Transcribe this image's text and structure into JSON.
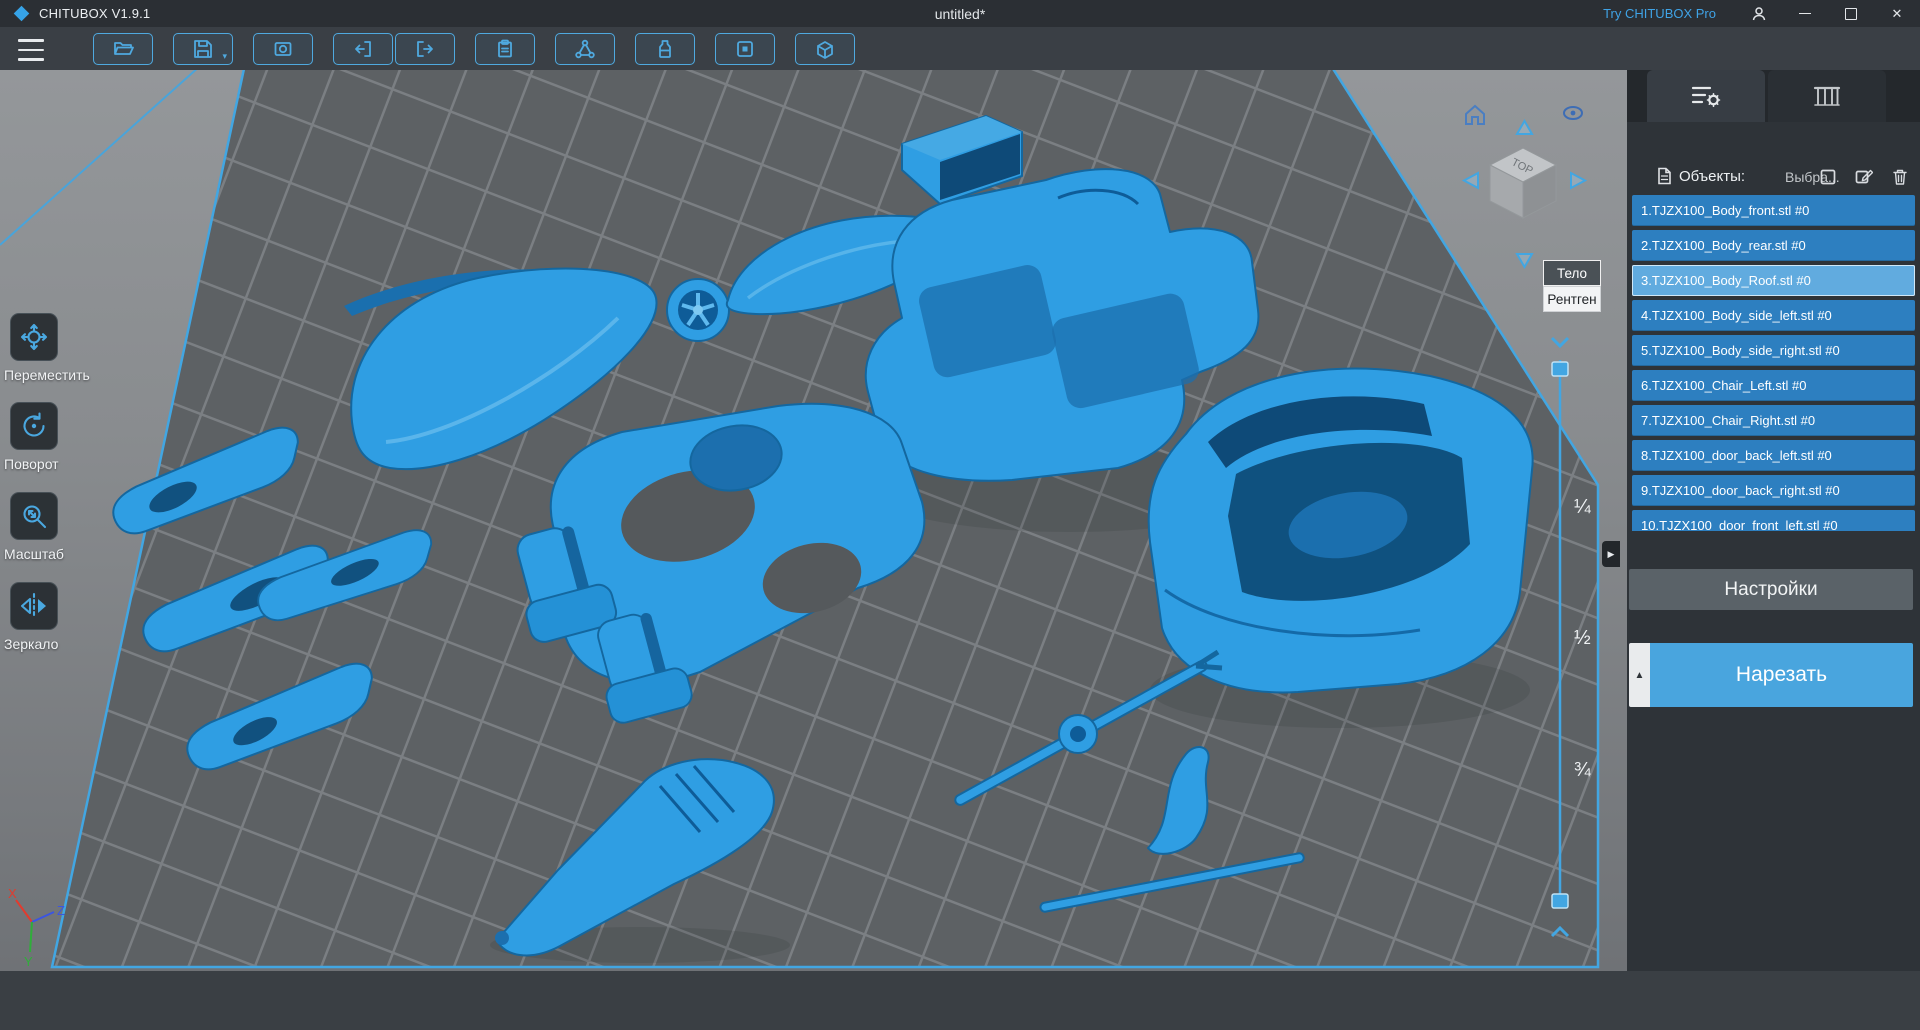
{
  "app": {
    "title": "CHITUBOX V1.9.1",
    "document": "untitled*",
    "pro_link": "Try CHITUBOX Pro"
  },
  "toolbar": {
    "icons": [
      "open-file",
      "save",
      "capture",
      "undo",
      "redo",
      "copy",
      "supports",
      "tank",
      "plate",
      "machine"
    ]
  },
  "left_tools": {
    "items": [
      {
        "icon": "move",
        "label": "Переместить"
      },
      {
        "icon": "rotate",
        "label": "Поворот"
      },
      {
        "icon": "scale",
        "label": "Масштаб"
      },
      {
        "icon": "mirror",
        "label": "Зеркало"
      }
    ]
  },
  "viewport": {
    "view_cube": {
      "top_label": "TOP"
    },
    "view_mode_menu": {
      "options": [
        {
          "label": "Тело",
          "active": true
        },
        {
          "label": "Рентген",
          "active": false
        }
      ]
    },
    "clip_slider": {
      "labels": [
        "¼",
        "½",
        "¾"
      ]
    },
    "axis_gizmo": {
      "x": "X",
      "y": "Y",
      "z": "Z"
    }
  },
  "right_panel": {
    "tabs": [
      {
        "icon": "settings-list",
        "active": true
      },
      {
        "icon": "supports",
        "active": false
      }
    ],
    "objects_header": {
      "label": "Объекты:",
      "selection": "Выбра..."
    },
    "object_list": [
      {
        "label": "1.TJZX100_Body_front.stl #0",
        "selected": false
      },
      {
        "label": "2.TJZX100_Body_rear.stl #0",
        "selected": false
      },
      {
        "label": "3.TJZX100_Body_Roof.stl #0",
        "selected": true
      },
      {
        "label": "4.TJZX100_Body_side_left.stl #0",
        "selected": false
      },
      {
        "label": "5.TJZX100_Body_side_right.stl #0",
        "selected": false
      },
      {
        "label": "6.TJZX100_Chair_Left.stl #0",
        "selected": false
      },
      {
        "label": "7.TJZX100_Chair_Right.stl #0",
        "selected": false
      },
      {
        "label": "8.TJZX100_door_back_left.stl #0",
        "selected": false
      },
      {
        "label": "9.TJZX100_door_back_right.stl #0",
        "selected": false
      },
      {
        "label": "10.TJZX100_door_front_left.stl #0",
        "selected": false
      }
    ],
    "settings_button": "Настройки",
    "slice_button": "Нарезать"
  },
  "colors": {
    "accent": "#42a6e2",
    "model_blue": "#2f9ee3",
    "list_row": "#2d7fc0",
    "list_row_selected": "#61abdf",
    "slice_button_bg": "#49a5de",
    "settings_button_bg": "#5a6268"
  }
}
